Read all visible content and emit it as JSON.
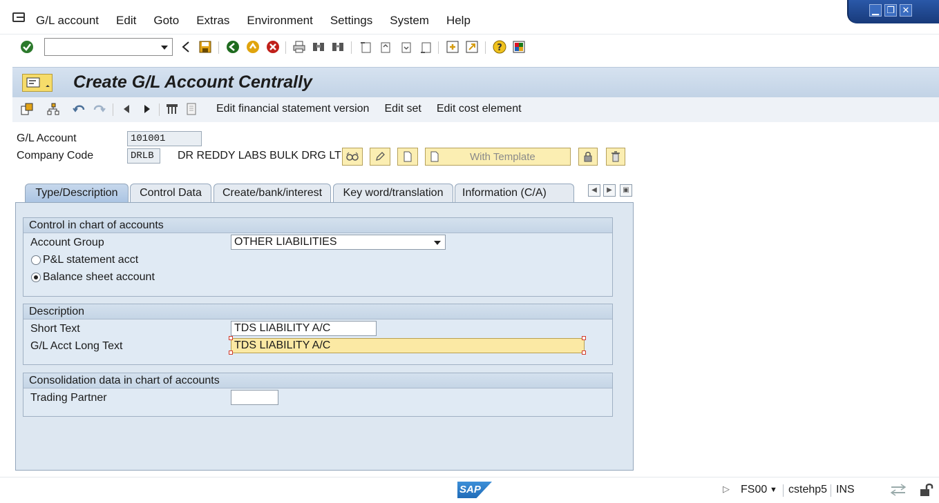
{
  "menubar": {
    "items": [
      "G/L account",
      "Edit",
      "Goto",
      "Extras",
      "Environment",
      "Settings",
      "System",
      "Help"
    ]
  },
  "window_controls": {
    "minimize": "▁",
    "maximize": "❐",
    "close": "✕"
  },
  "toolbar": {
    "command_field_value": "",
    "icons": [
      "enter-icon",
      "back-arrow-icon",
      "save-icon",
      "back-icon",
      "exit-icon",
      "cancel-icon",
      "print-icon",
      "find-icon",
      "find-next-icon",
      "first-page-icon",
      "prev-page-icon",
      "next-page-icon",
      "last-page-icon",
      "create-session-icon",
      "shortcut-icon",
      "help-icon",
      "layout-icon"
    ]
  },
  "title": "Create G/L Account Centrally",
  "app_toolbar": {
    "links": [
      "Edit financial statement version",
      "Edit set",
      "Edit cost element"
    ]
  },
  "header": {
    "gl_account_label": "G/L Account",
    "gl_account_value": "101001",
    "company_code_label": "Company Code",
    "company_code_value": "DRLB",
    "company_name": "DR REDDY LABS BULK DRG LT",
    "with_template_label": "With Template"
  },
  "tabs": [
    "Type/Description",
    "Control Data",
    "Create/bank/interest",
    "Key word/translation",
    "Information (C/A)"
  ],
  "groups": {
    "control": {
      "title": "Control in chart of accounts",
      "account_group_label": "Account Group",
      "account_group_value": "OTHER LIABILITIES",
      "pl_label": "P&L statement acct",
      "bs_label": "Balance sheet account",
      "selected": "bs"
    },
    "description": {
      "title": "Description",
      "short_text_label": "Short Text",
      "short_text_value": "TDS LIABILITY A/C",
      "long_text_label": "G/L Acct Long Text",
      "long_text_value": "TDS LIABILITY A/C"
    },
    "consolidation": {
      "title": "Consolidation data in chart of accounts",
      "trading_partner_label": "Trading Partner",
      "trading_partner_value": ""
    }
  },
  "statusbar": {
    "logo": "SAP",
    "transaction": "FS00",
    "server": "cstehp5",
    "mode": "INS"
  },
  "colors": {
    "title_bg": "#c2d3e6",
    "highlight_field": "#fbe9a4",
    "panel_bg": "#dde7f1"
  }
}
